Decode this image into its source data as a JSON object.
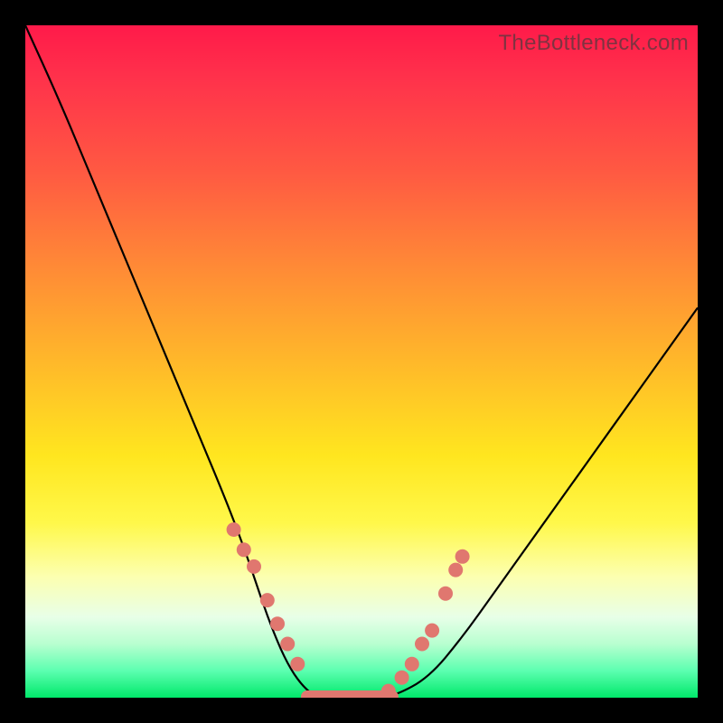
{
  "watermark": "TheBottleneck.com",
  "colors": {
    "frame_bg": "#000000",
    "marker": "#e0776f",
    "curve": "#000000",
    "gradient_top": "#ff1a4a",
    "gradient_bottom": "#00e86a"
  },
  "chart_data": {
    "type": "line",
    "title": "",
    "xlabel": "",
    "ylabel": "",
    "xlim": [
      0,
      100
    ],
    "ylim": [
      0,
      100
    ],
    "x": [
      0,
      5,
      10,
      15,
      20,
      25,
      30,
      33,
      35,
      37,
      39,
      41,
      43,
      45,
      48,
      52,
      55,
      60,
      65,
      70,
      75,
      80,
      85,
      90,
      95,
      100
    ],
    "y": [
      100,
      89,
      77,
      65,
      53,
      41,
      29,
      21,
      15,
      9.5,
      5,
      2,
      0.2,
      0,
      0,
      0,
      0.3,
      3,
      9,
      16,
      23,
      30,
      37,
      44,
      51,
      58
    ],
    "series": [
      {
        "name": "bottleneck-curve",
        "color": "#000000",
        "x": [
          0,
          5,
          10,
          15,
          20,
          25,
          30,
          33,
          35,
          37,
          39,
          41,
          43,
          45,
          48,
          52,
          55,
          60,
          65,
          70,
          75,
          80,
          85,
          90,
          95,
          100
        ],
        "y": [
          100,
          89,
          77,
          65,
          53,
          41,
          29,
          21,
          15,
          9.5,
          5,
          2,
          0.2,
          0,
          0,
          0,
          0.3,
          3,
          9,
          16,
          23,
          30,
          37,
          44,
          51,
          58
        ]
      }
    ],
    "markers": {
      "color": "#e0776f",
      "points_left": [
        [
          31,
          25
        ],
        [
          32.5,
          22
        ],
        [
          34,
          19.5
        ],
        [
          36,
          14.5
        ],
        [
          37.5,
          11
        ],
        [
          39,
          8
        ],
        [
          40.5,
          5
        ]
      ],
      "points_right": [
        [
          54,
          1
        ],
        [
          56,
          3
        ],
        [
          57.5,
          5
        ],
        [
          59,
          8
        ],
        [
          60.5,
          10
        ],
        [
          62.5,
          15.5
        ],
        [
          64,
          19
        ],
        [
          65,
          21
        ]
      ],
      "baseline_span_x": [
        41,
        55.5
      ]
    },
    "annotations": []
  }
}
